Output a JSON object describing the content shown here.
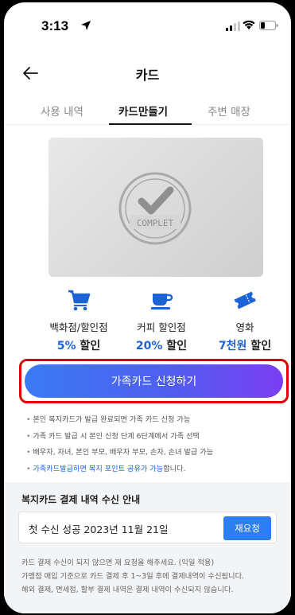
{
  "status_bar": {
    "time": "3:13"
  },
  "header": {
    "title": "카드"
  },
  "tabs": [
    {
      "label": "사용 내역"
    },
    {
      "label": "카드만들기"
    },
    {
      "label": "주변 매장"
    }
  ],
  "card": {
    "seal_text": "COMPLET"
  },
  "benefits": [
    {
      "icon": "cart-icon",
      "label": "백화점/할인점",
      "highlight": "5%",
      "suffix": " 할인"
    },
    {
      "icon": "coffee-cup-icon",
      "label": "커피 할인점",
      "highlight": "20%",
      "suffix": " 할인"
    },
    {
      "icon": "movie-ticket-icon",
      "label": "영화",
      "highlight": "7천원",
      "suffix": " 할인"
    }
  ],
  "apply_button": {
    "label": "가족카드 신청하기"
  },
  "notes": [
    "본인 복지카드가 발급 완료되면 가족 카드 신청 가능",
    "가족 카드 발급 시 본인 신청 단계 6단계에서 가족 선택",
    "배우자, 자녀, 본인 부모, 배우자 부모, 손자, 손녀 발급 가능"
  ],
  "note_highlight": {
    "blue": "가족카드발급하면 복지 포인트 공유가 가능",
    "rest": "합니다."
  },
  "payment_notice": {
    "title": "복지카드 결제 내역 수신 안내",
    "result": "첫 수신 성공  2023년 11월 21일",
    "rerequest_label": "재요청",
    "footnotes": [
      "카드 결제 수신이 되지 않으면 재 요청을 해주세요. (익일 적용)",
      "가맹점 매입 기준으로 카드 결제 후 1~3일 후에 결제내역이 수신됩니다.",
      "해외 결제, 면세점, 할부 결제 내역은 결제 내역이 수신되지 않습니다."
    ]
  },
  "colors": {
    "accent_blue": "#1e63d6",
    "button_start": "#3a7bf2",
    "button_end": "#7b3ef2",
    "highlight_border": "#e00000",
    "rerequest_button": "#2f7df3"
  }
}
